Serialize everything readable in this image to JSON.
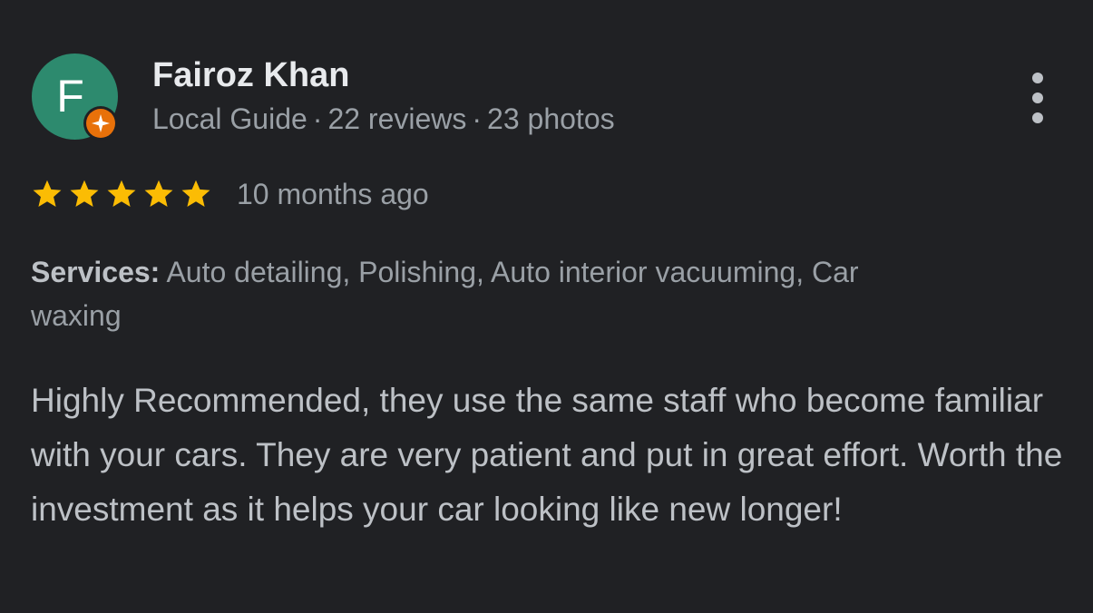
{
  "author": {
    "initial": "F",
    "avatar_color": "#2d8a6e",
    "badge_color": "#e8710a",
    "badge_icon": "local-guide-star-icon",
    "name": "Fairoz Khan",
    "role": "Local Guide",
    "separator": "·",
    "reviews": "22 reviews",
    "photos": "23 photos"
  },
  "menu": {
    "icon": "more-vert-icon"
  },
  "rating": {
    "stars": 5,
    "max": 5,
    "star_color": "#fbbc04",
    "date": "10 months ago"
  },
  "services": {
    "label": "Services:",
    "value": " Auto detailing, Polishing, Auto interior vacuuming, Car waxing"
  },
  "review": {
    "text": "Highly Recommended, they use the same staff who become familiar with your cars. They are very patient and put in great effort. Worth the investment as it helps your car looking like new longer!"
  }
}
